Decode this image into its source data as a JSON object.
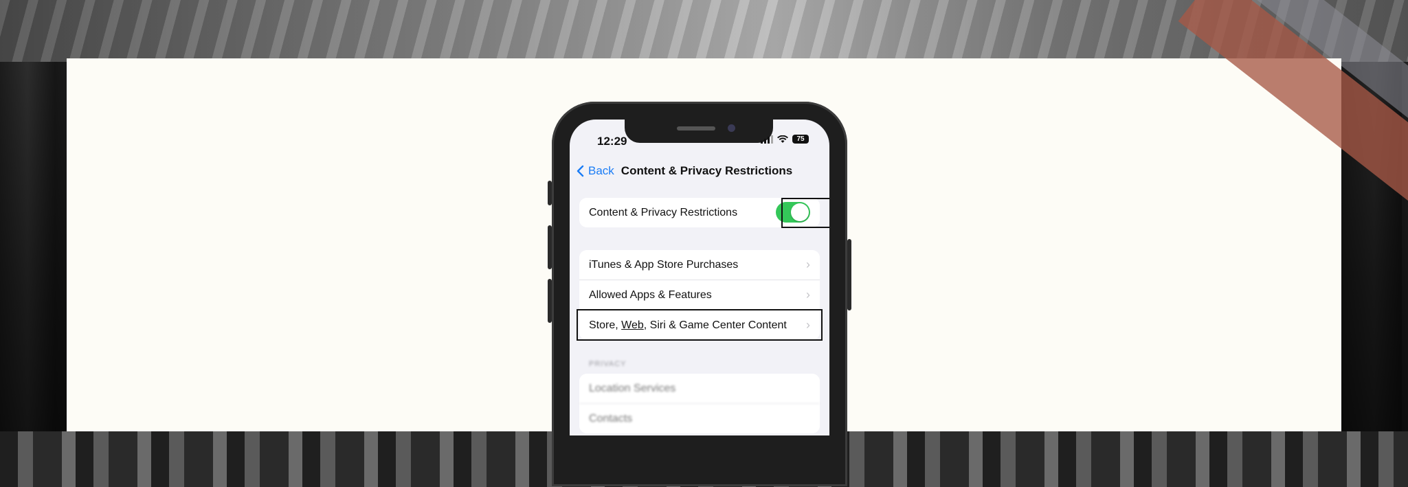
{
  "status": {
    "time": "12:29",
    "battery": "75"
  },
  "nav": {
    "back_label": "Back",
    "title": "Content & Privacy Restrictions"
  },
  "toggle_row": {
    "label": "Content & Privacy Restrictions",
    "on": true
  },
  "settings_group": {
    "items": [
      {
        "label": "iTunes & App Store Purchases"
      },
      {
        "label": "Allowed Apps & Features"
      },
      {
        "label_parts": [
          "Store, ",
          "Web",
          ", Siri & Game Center Content"
        ]
      }
    ]
  },
  "privacy": {
    "header": "PRIVACY",
    "items": [
      {
        "label": "Location Services"
      },
      {
        "label": "Contacts"
      }
    ]
  },
  "colors": {
    "accent": "#1a7cf5",
    "toggle_on": "#34c759",
    "stripe": "#a65846"
  }
}
